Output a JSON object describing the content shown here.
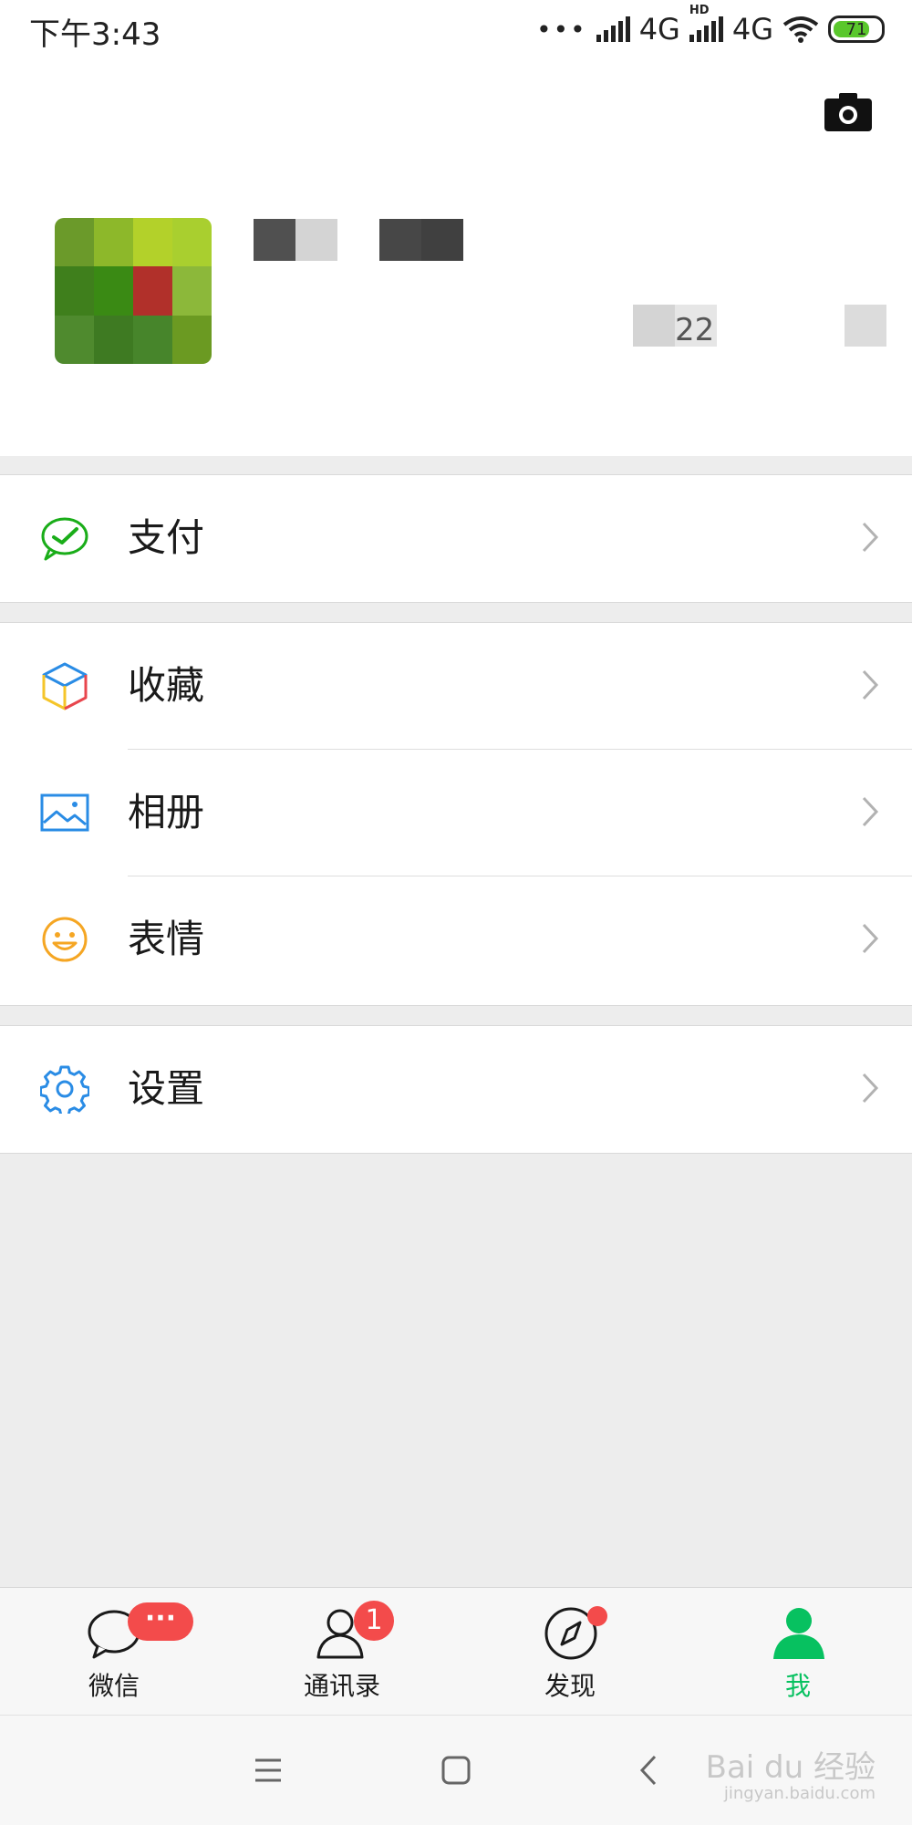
{
  "status_bar": {
    "time": "下午3:43",
    "network_1": "4G",
    "network_2_hd": "HD",
    "network_2": "4G",
    "battery_level": "71",
    "battery_color": "#5ac72c"
  },
  "header": {
    "camera_icon": "camera-icon",
    "profile_number_fragment": "22"
  },
  "menu": {
    "pay": {
      "label": "支付",
      "icon": "wechat-pay-icon",
      "color": "#1aad19"
    },
    "favorites": {
      "label": "收藏",
      "icon": "favorites-cube-icon"
    },
    "album": {
      "label": "相册",
      "icon": "album-image-icon",
      "color": "#2a8ce5"
    },
    "stickers": {
      "label": "表情",
      "icon": "smiley-icon",
      "color": "#f5a623"
    },
    "settings": {
      "label": "设置",
      "icon": "gear-icon",
      "color": "#2a8ce5"
    }
  },
  "tabbar": {
    "chats": {
      "label": "微信",
      "icon": "chat-bubble-icon",
      "badge": "···"
    },
    "contacts": {
      "label": "通讯录",
      "icon": "contacts-icon",
      "badge": "1"
    },
    "discover": {
      "label": "发现",
      "icon": "compass-icon"
    },
    "me": {
      "label": "我",
      "icon": "person-icon",
      "active_color": "#07c160"
    }
  },
  "watermark": {
    "main": "Bai du 经验",
    "sub": "jingyan.baidu.com"
  }
}
